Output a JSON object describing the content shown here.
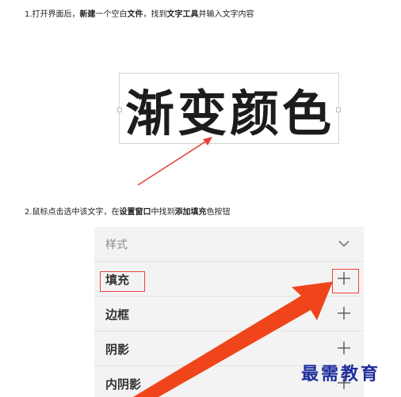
{
  "step1": {
    "parts": [
      "1.打开界面后，",
      "新建",
      "一个空白",
      "文件",
      "，找到",
      "文字工具",
      "并输入文字内容"
    ],
    "bold": [
      false,
      true,
      false,
      true,
      false,
      true,
      false
    ]
  },
  "canvas": {
    "text": "渐变颜色"
  },
  "step2": {
    "parts": [
      "2.鼠标点击选中该文字，在",
      "设置窗口",
      "中找到",
      "添加填充",
      "色按钮"
    ],
    "bold": [
      false,
      true,
      false,
      true,
      false
    ]
  },
  "panel": {
    "header": {
      "label": "样式",
      "icon": "chevron-down-icon"
    },
    "rows": [
      {
        "label": "填充",
        "icon": "plus-icon",
        "highlighted": true
      },
      {
        "label": "边框",
        "icon": "plus-icon",
        "highlighted": false
      },
      {
        "label": "阴影",
        "icon": "plus-icon",
        "highlighted": false
      },
      {
        "label": "内阴影",
        "icon": "plus-icon",
        "highlighted": false
      }
    ]
  },
  "watermark": "最需教育",
  "colors": {
    "annotation_red": "#e8413c",
    "watermark_blue": "#1f2d9c",
    "panel_bg": "#f3f3f3"
  }
}
